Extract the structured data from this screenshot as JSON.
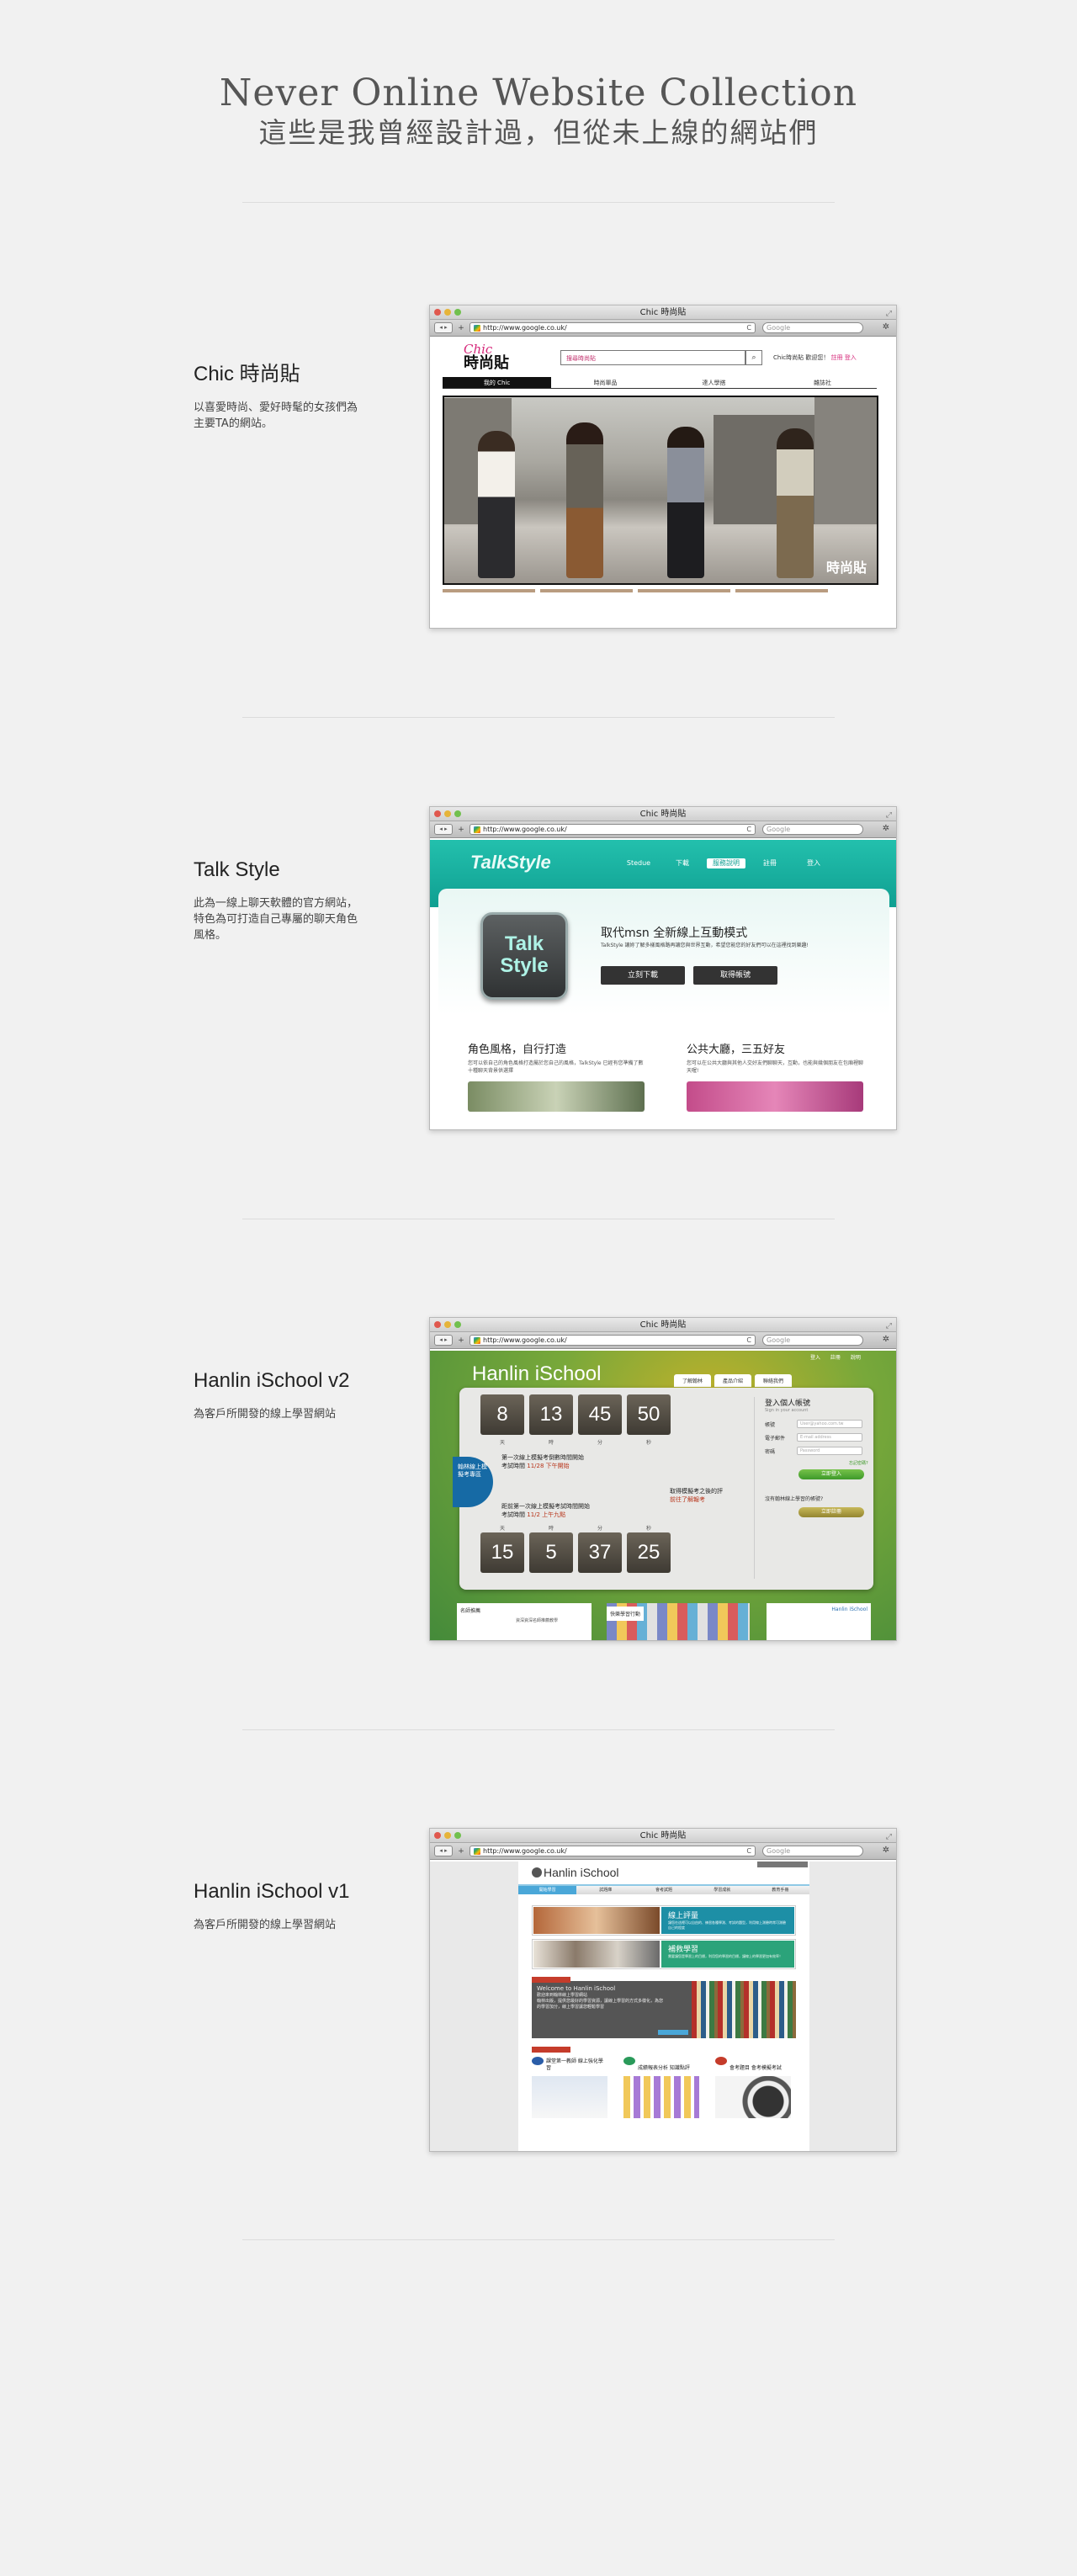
{
  "header": {
    "title_en": "Never Online Website Collection",
    "title_zh": "這些是我曾經設計過，但從未上線的網站們"
  },
  "browser": {
    "url": "http://www.google.co.uk/",
    "search_placeholder": "Google",
    "back": "◂",
    "forward": "▸",
    "add": "+",
    "reload": "C",
    "gear": "✲",
    "resize": "⤢"
  },
  "projects": [
    {
      "title": "Chic 時尚貼",
      "desc": "以喜愛時尚、愛好時髦的女孩們為主要TA的網站。",
      "window_title": "Chic 時尚貼"
    },
    {
      "title": "Talk Style",
      "desc": "此為一線上聊天軟體的官方網站，特色為可打造自己專屬的聊天角色風格。",
      "window_title": "Chic 時尚貼"
    },
    {
      "title": "Hanlin iSchool v2",
      "desc": "為客戶所開發的線上學習網站",
      "window_title": "Chic 時尚貼"
    },
    {
      "title": "Hanlin iSchool v1",
      "desc": "為客戶所開發的線上學習網站",
      "window_title": "Chic 時尚貼"
    }
  ],
  "chic": {
    "logo_script": "Chic",
    "logo_main": "時尚貼",
    "search_placeholder": "搜尋時尚貼",
    "search_icon": "magnifier",
    "user_text": "Chic時尚貼 歡迎您！",
    "user_links": "註冊 登入",
    "nav": [
      "我的 Chic",
      "時尚單品",
      "達人學搭",
      "雜誌社"
    ],
    "hero_logo": "時尚貼"
  },
  "talkstyle": {
    "logo": "TalkStyle",
    "nav": [
      "Stedue",
      "下載",
      "服務說明",
      "註冊",
      "登入"
    ],
    "icon_line1": "Talk",
    "icon_line2": "Style",
    "headline": "取代msn 全新線上互動模式",
    "subline": "TalkStyle 讓妳了解多樣風格路再讓您與世界互動，希望您能您的好友們可以在這裡找到樂趣!",
    "btn_download": "立刻下載",
    "btn_account": "取得帳號",
    "col1_title": "角色風格，自行打造",
    "col1_text": "您可以依自己的角色風格打造屬於您自己的風格，TalkStyle 已經有您準備了數十種聊天背景供選擇",
    "col2_title": "公共大廳，三五好友",
    "col2_text": "您可以在公共大廳與其他人交好友們聊聊天，互動，也能與幾個朋友在包廂裡聊天喔!"
  },
  "hanlin2": {
    "logo": "Hanlin iSchool",
    "toplinks": "登入 註冊 說明",
    "tabs": [
      "了解翰林",
      "產品介紹",
      "聯絡我們"
    ],
    "count1": [
      "8",
      "13",
      "45",
      "50"
    ],
    "count2": [
      "15",
      "5",
      "37",
      "25"
    ],
    "count_labels": [
      "天",
      "時",
      "分",
      "秒"
    ],
    "event1": "第一次線上模擬考倒數時間開始",
    "event1_date": "考試時間",
    "event1_when": "11/28 下午開始",
    "event2": "距前第一次線上模擬考試時間開始",
    "event2_date": "考試時間",
    "event2_when": "11/2 上午九點",
    "mid_note": "取得模擬考之後的評",
    "mid_link": "前往了解報考",
    "badge": "翰林線上模擬考專區",
    "login_title": "登入個人帳號",
    "login_sub": "Sign in your account",
    "login_fields": [
      {
        "label": "帳號",
        "placeholder": "User@yahoo.com.tw"
      },
      {
        "label": "電子郵件",
        "placeholder": "E-mail address"
      },
      {
        "label": "密碼",
        "placeholder": "Password"
      }
    ],
    "forgot": "忘記密碼?",
    "login_btn": "立即登入",
    "register_q": "沒有翰林線上學習的帳號?",
    "register_btn": "立即註冊",
    "bottom1": "名師推薦",
    "bottom1_note": "資深資深名師推薦教學",
    "bottom2": "快樂學習行動",
    "bottom3": "Hanlin iSchool"
  },
  "hanlin1": {
    "logo": "Hanlin iSchool",
    "nav": [
      "開始學習",
      "試題庫",
      "會考試題",
      "學習成就",
      "教育手冊"
    ],
    "tile1_title": "線上評量",
    "tile1_text": "讓您在這裡可以自由的、練習各種學測、考試的題型，利用線上測驗時常可測驗自己的程度",
    "tile2_title": "補救學習",
    "tile2_text": "需要讓您是學習上的目標，利用您的學習的目標，讓線上的學習更加有效率！",
    "welcome_title": "Welcome to Hanlin iSchool",
    "welcome_sub": "歡迎來到翰林線上學習網站",
    "welcome_text": "翰林出版，提供您最好的學習資源，讓線上學習的方式多樣化，為您的學習加分，線上學習讓您輕鬆學習",
    "item1": "課堂第一教師 線上強化學習",
    "item2": "成績報表分析 知識點評",
    "item3": "會考題目 會考模擬考試"
  },
  "colors": {
    "page_bg": "#f1f1f1",
    "chic_accent": "#d6287a",
    "talkstyle_teal": "#1fb8a5",
    "hanlin_green": "#6aa438",
    "hanlin_blue": "#4aa7d8"
  }
}
